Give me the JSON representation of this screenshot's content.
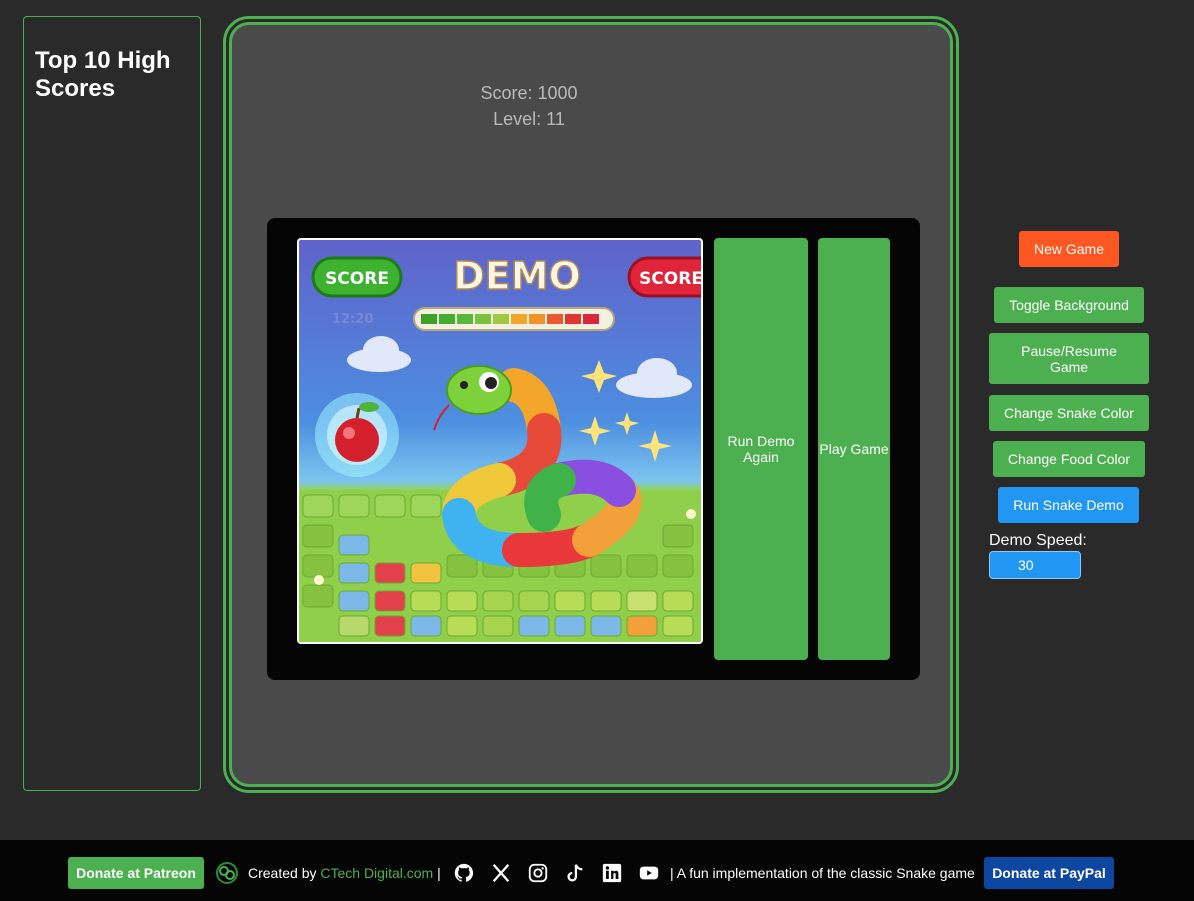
{
  "high_scores": {
    "title": "Top 10 High Scores"
  },
  "game": {
    "score_text": "Score: 1000",
    "level_text": "Level: 11",
    "run_demo_again_label": "Run Demo Again",
    "play_game_label": "Play Game"
  },
  "demo_image": {
    "left_badge": "SCORE",
    "title": "DEMO",
    "right_badge": "SCORE",
    "timer": "12:20"
  },
  "controls": {
    "new_game": "New Game",
    "toggle_background": "Toggle Background",
    "pause_resume": "Pause/Resume Game",
    "change_snake_color": "Change Snake Color",
    "change_food_color": "Change Food Color",
    "run_snake_demo": "Run Snake Demo",
    "demo_speed_label": "Demo Speed:",
    "demo_speed_value": "30"
  },
  "footer": {
    "patreon_label": "Donate at Patreon",
    "created_by": "Created by",
    "creator_link": "CTech Digital.com",
    "separator": "|",
    "tagline": "| A fun implementation of the classic Snake game",
    "paypal_label": "Donate at PayPal",
    "icons": [
      "logo-icon",
      "github-icon",
      "x-icon",
      "instagram-icon",
      "tiktok-icon",
      "linkedin-icon",
      "youtube-icon"
    ]
  },
  "colors": {
    "accent_green": "#4caf50",
    "new_game_orange": "#ff5722",
    "demo_blue": "#2196f3",
    "paypal_blue": "#0d47a1"
  }
}
